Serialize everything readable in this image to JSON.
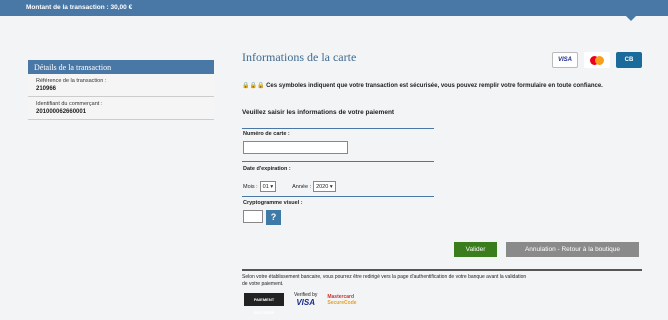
{
  "header": {
    "amount_label": "Montant de la transaction : 30,00 €"
  },
  "details": {
    "title": "Détails de la transaction",
    "ref_label": "Référence de la transaction :",
    "ref_value": "210966",
    "merchant_label": "Identifiant du commerçant :",
    "merchant_value": "201000062660001"
  },
  "form": {
    "title": "Informations de la carte",
    "cards": [
      "VISA",
      "mastercard",
      "CB"
    ],
    "secure_text": "Ces symboles indiquent que votre transaction est sécurisée, vous pouvez remplir votre formulaire en toute confiance.",
    "fill_title": "Veuillez saisir les informations de votre paiement",
    "card_number_label": "Numéro de carte :",
    "card_number_value": "",
    "expiry_label": "Date d'expiration :",
    "month_label": "Mois :",
    "month_value": "01",
    "year_label": "Année :",
    "year_value": "2020",
    "cvv_label": "Cryptogramme visuel :",
    "cvv_help": "?",
    "validate_label": "Valider",
    "cancel_label": "Annulation - Retour à la boutique"
  },
  "footer": {
    "notice": "Selon votre établissement bancaire, vous pourrez être redirigé vers la page d'authentification de votre banque avant la validation de votre paiement.",
    "logo1": "PAIEMENT SÉCURISÉ",
    "logo2_top": "Verified by",
    "logo2_bottom": "VISA",
    "logo3_top": "Mastercard",
    "logo3_bottom": "SecureCode"
  },
  "colors": {
    "brand": "#4a78a6",
    "validate": "#3a7d1c",
    "cancel": "#8a8a8a"
  }
}
